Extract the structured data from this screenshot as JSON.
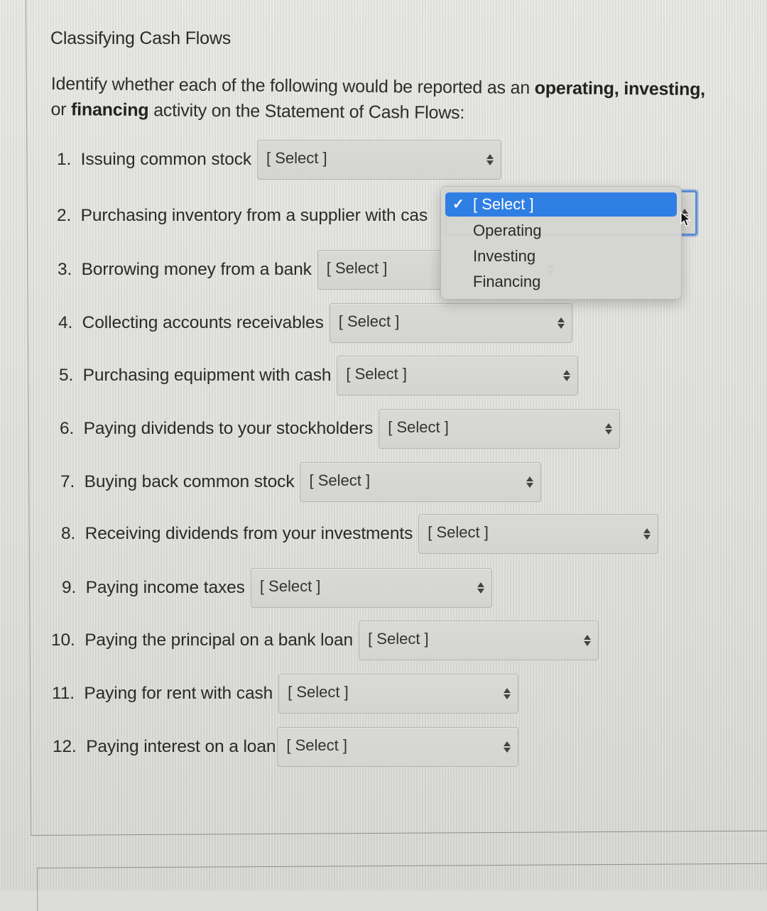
{
  "title": "Classifying Cash Flows",
  "prompt": {
    "part1": "Identify whether each of the following would be reported as an ",
    "bold1": "operating, investing,",
    "part2": " or ",
    "bold2": "financing",
    "part3": " activity on the Statement of Cash Flows:"
  },
  "questions": [
    {
      "number": "1.",
      "text": "Issuing common stock",
      "selected": "[ Select ]"
    },
    {
      "number": "2.",
      "text": "Purchasing inventory from a supplier with cas",
      "selected": "[ Select ]"
    },
    {
      "number": "3.",
      "text": "Borrowing money from a bank",
      "selected": "[ Select ]"
    },
    {
      "number": "4.",
      "text": "Collecting accounts receivables",
      "selected": "[ Select ]"
    },
    {
      "number": "5.",
      "text": "Purchasing equipment with cash",
      "selected": "[ Select ]"
    },
    {
      "number": "6.",
      "text": "Paying dividends to your stockholders",
      "selected": "[ Select ]"
    },
    {
      "number": "7.",
      "text": "Buying back common stock",
      "selected": "[ Select ]"
    },
    {
      "number": "8.",
      "text": "Receiving dividends from your investments",
      "selected": "[ Select ]"
    },
    {
      "number": "9.",
      "text": "Paying income taxes",
      "selected": "[ Select ]"
    },
    {
      "number": "10.",
      "text": "Paying the principal on a bank loan",
      "selected": "[ Select ]"
    },
    {
      "number": "11.",
      "text": "Paying for rent with cash",
      "selected": "[ Select ]"
    },
    {
      "number": "12.",
      "text": "Paying interest on a loan",
      "selected": "[ Select ]"
    }
  ],
  "dropdown": {
    "open_for_question": 2,
    "check_glyph": "✓",
    "options": [
      "[ Select ]",
      "Operating",
      "Investing",
      "Financing"
    ],
    "selected_index": 0
  },
  "colors": {
    "highlight": "#2f7ee3",
    "focus_ring": "#5b8fd6"
  }
}
